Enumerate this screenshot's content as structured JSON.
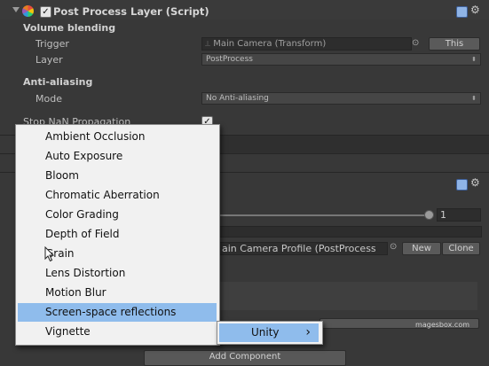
{
  "component": {
    "title": "Post Process Layer (Script)",
    "enabled_check": "✓"
  },
  "volume_blending": {
    "header": "Volume blending",
    "trigger_label": "Trigger",
    "trigger_value": "Main Camera (Transform)",
    "this_button": "This",
    "layer_label": "Layer",
    "layer_value": "PostProcess"
  },
  "anti_aliasing": {
    "header": "Anti-aliasing",
    "mode_label": "Mode",
    "mode_value": "No Anti-aliasing"
  },
  "stop_nan": {
    "label": "Stop NaN Propagation",
    "check": "✓"
  },
  "second_component": {
    "slider_value": "1",
    "profile_value": "ain Camera Profile (PostProcess",
    "new_button": "New",
    "clone_button": "Clone",
    "watermark": "magesbox.com",
    "add_component": "Add Component"
  },
  "menu": {
    "items": [
      "Ambient Occlusion",
      "Auto Exposure",
      "Bloom",
      "Chromatic Aberration",
      "Color Grading",
      "Depth of Field",
      "Grain",
      "Lens Distortion",
      "Motion Blur",
      "Screen-space reflections",
      "Vignette"
    ],
    "selected_index": 9
  },
  "submenu": {
    "label": "Unity",
    "arrow": "›"
  },
  "colors": {
    "background": "#383838",
    "menu_background": "#f1f1f1",
    "menu_highlight": "#8fbcec"
  }
}
